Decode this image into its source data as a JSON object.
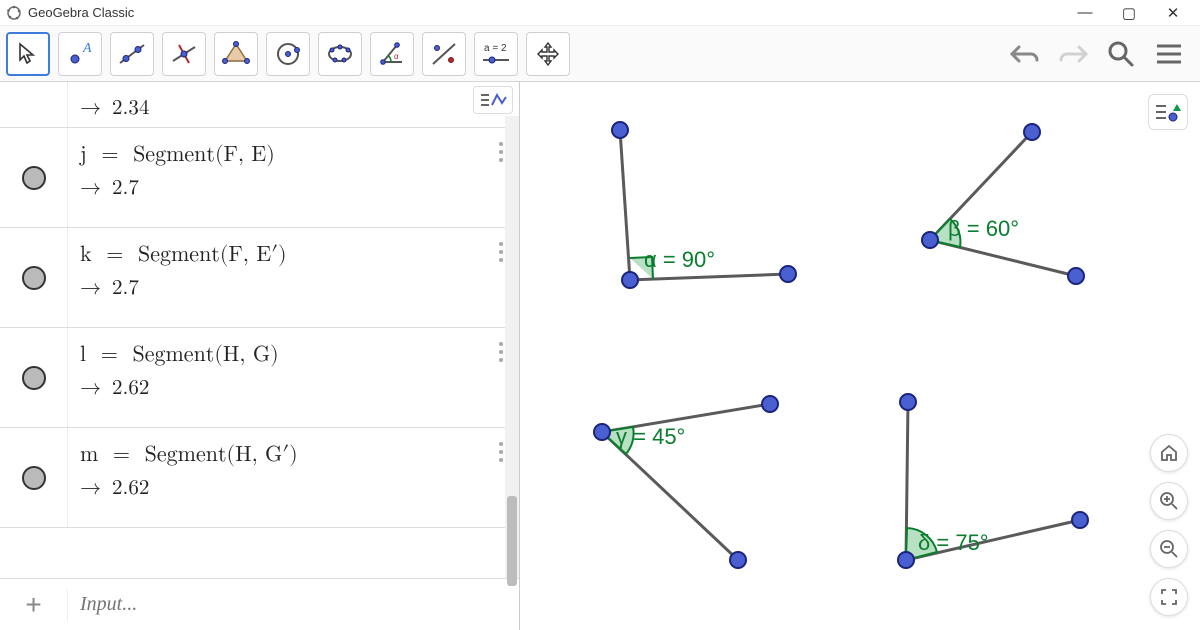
{
  "title": "GeoGebra Classic",
  "window_controls": {
    "minimize": "—",
    "maximize": "▢",
    "close": "✕"
  },
  "toolbar": {
    "tools": [
      {
        "name": "move-tool",
        "selected": true
      },
      {
        "name": "point-tool"
      },
      {
        "name": "line-tool"
      },
      {
        "name": "perpendicular-tool"
      },
      {
        "name": "polygon-tool"
      },
      {
        "name": "circle-tool"
      },
      {
        "name": "conic-tool"
      },
      {
        "name": "angle-tool"
      },
      {
        "name": "reflect-tool"
      },
      {
        "name": "slider-tool",
        "label": "a = 2"
      },
      {
        "name": "move-graphics-tool"
      }
    ]
  },
  "algebra": {
    "prev_result": "2.34",
    "rows": [
      {
        "name": "j",
        "def": "Segment(F, E)",
        "result": "2.7"
      },
      {
        "name": "k",
        "def": "Segment(F, E′)",
        "result": "2.7"
      },
      {
        "name": "l",
        "def": "Segment(H, G)",
        "result": "2.62"
      },
      {
        "name": "m",
        "def": "Segment(H, G′)",
        "result": "2.62"
      }
    ],
    "input_placeholder": "Input..."
  },
  "angles": {
    "alpha": {
      "symbol": "α",
      "value": "= 90°"
    },
    "beta": {
      "symbol": "β",
      "value": "= 60°"
    },
    "gamma": {
      "symbol": "γ",
      "value": "= 45°"
    },
    "delta": {
      "symbol": "δ",
      "value": "= 75°"
    }
  },
  "colors": {
    "point_fill": "#4a5fd0",
    "point_stroke": "#1a237e",
    "segment": "#5a5a5a",
    "angle": "#0a7d2e",
    "angle_fill": "#b8e0c2"
  }
}
